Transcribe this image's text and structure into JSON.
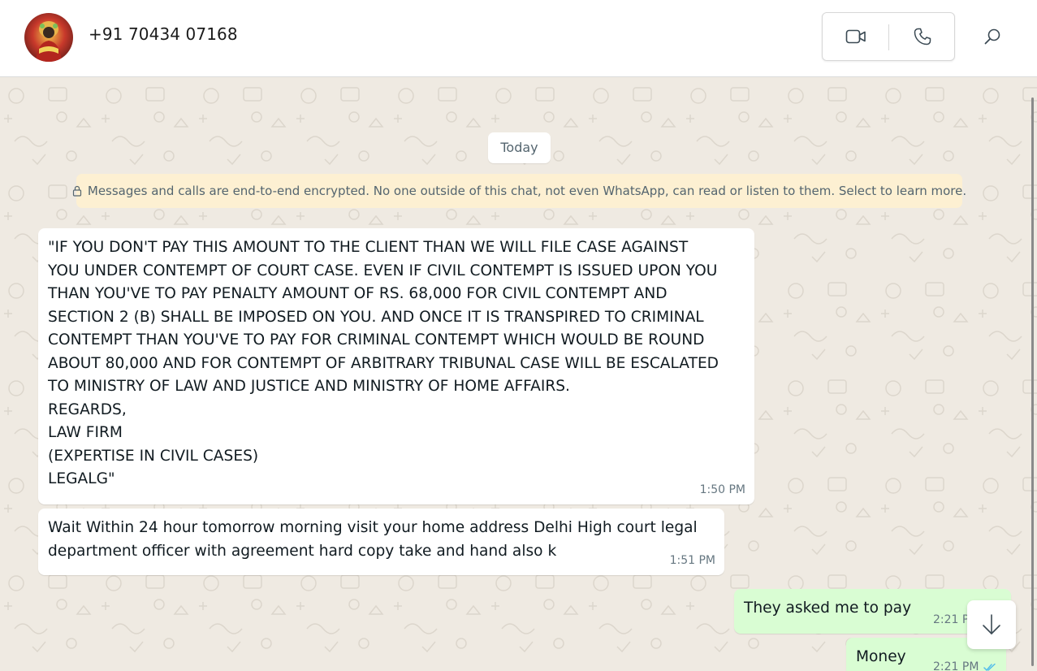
{
  "header": {
    "contact_name": "+91 70434 07168",
    "icons": {
      "avatar": "avatar-photo",
      "video": "video-camera-icon",
      "voice": "phone-icon",
      "search": "search-icon"
    }
  },
  "chat": {
    "date_chip": "Today",
    "encryption_notice": "Messages and calls are end-to-end encrypted. No one outside of this chat, not even WhatsApp, can read or listen to them. Select to learn more.",
    "messages": [
      {
        "direction": "incoming",
        "text": "\"IF YOU DON'T PAY THIS AMOUNT TO THE CLIENT THAN WE WILL FILE CASE AGAINST\nYOU UNDER CONTEMPT OF COURT CASE. EVEN IF CIVIL CONTEMPT IS ISSUED UPON YOU\nTHAN YOU'VE TO PAY PENALTY AMOUNT OF RS. 68,000 FOR CIVIL CONTEMPT AND\nSECTION 2 (B) SHALL BE IMPOSED ON YOU. AND ONCE IT IS TRANSPIRED TO CRIMINAL\nCONTEMPT THAN YOU'VE TO PAY FOR CRIMINAL CONTEMPT WHICH WOULD BE ROUND\nABOUT 80,000 AND FOR CONTEMPT OF ARBITRARY TRIBUNAL CASE WILL BE ESCALATED\nTO MINISTRY OF LAW AND JUSTICE AND MINISTRY OF HOME AFFAIRS.\nREGARDS,\nLAW FIRM\n(EXPERTISE IN CIVIL CASES)\nLEGALG\"",
        "time": "1:50 PM"
      },
      {
        "direction": "incoming",
        "text": "Wait Within 24 hour tomorrow morning visit your home address Delhi High court legal\ndepartment officer with agreement hard copy take and hand also k",
        "time": "1:51 PM"
      },
      {
        "direction": "outgoing",
        "text": "They asked me to pay",
        "time": "2:21 PM"
      },
      {
        "direction": "outgoing",
        "text": "Money",
        "time": "2:21 PM",
        "status": "read"
      }
    ]
  },
  "colors": {
    "incoming_bubble": "#ffffff",
    "outgoing_bubble": "#d9fdd3",
    "banner": "#fdf0d2",
    "read_tick": "#53bdeb"
  }
}
